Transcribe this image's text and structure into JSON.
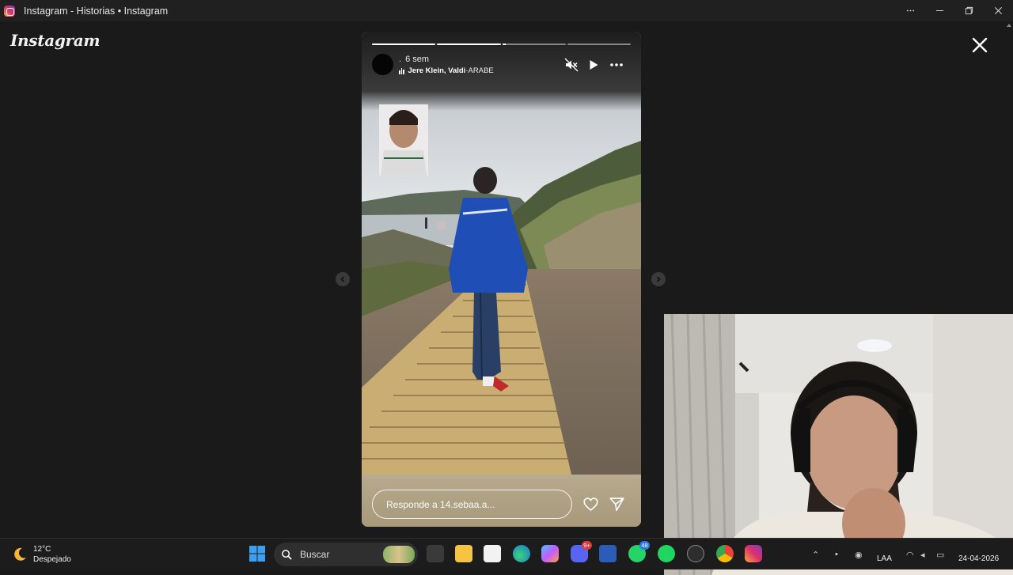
{
  "window": {
    "title": "Instagram - Historias • Instagram"
  },
  "app": {
    "logo": "Instagram",
    "close_icon": "close-icon"
  },
  "story": {
    "progress": [
      1,
      1,
      0.05,
      0
    ],
    "user_dot": ".",
    "time_ago": "6 sem",
    "music_artist": "Jere Klein, Valdi",
    "music_separator": " · ",
    "music_song": "ARABE",
    "reply_placeholder": "Responde a 14.sebaa.a..."
  },
  "taskbar": {
    "weather_temp": "12°C",
    "weather_desc": "Despejado",
    "search_placeholder": "Buscar",
    "discord_badge": "9+",
    "whatsapp_badge": "48",
    "language": "LAA",
    "date": "24-04-2026"
  },
  "colors": {
    "titlebar": "#202020",
    "background": "#1a1a1a",
    "reply_bar": "#ad9f82",
    "jacket_blue": "#1f4fb6"
  }
}
